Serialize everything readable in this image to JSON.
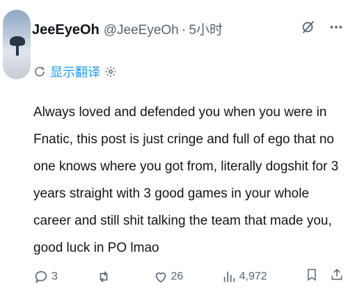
{
  "tweet": {
    "display_name": "JeeEyeOh",
    "handle": "@JeeEyeOh",
    "separator": "·",
    "time": "5小时",
    "translate_label": "显示翻译",
    "text": "Always loved and defended you when you were in Fnatic, this post is just cringe and full of ego that no one knows where you got from, literally dogshit for 3 years straight with 3 good games in your whole career and still shit talking the team that made you, good luck in PO lmao"
  },
  "actions": {
    "replies": "3",
    "reposts": "",
    "likes": "26",
    "views": "4,972"
  },
  "icons": {
    "reply": "reply-icon",
    "repost": "repost-icon",
    "like": "heart-icon",
    "views": "views-icon",
    "bookmark": "bookmark-icon",
    "share": "share-icon",
    "grok": "grok-icon",
    "more": "more-icon",
    "translate": "translate-icon",
    "settings": "gear-icon"
  },
  "colors": {
    "text": "#0f1419",
    "muted": "#536471",
    "link": "#1d9bf0"
  }
}
